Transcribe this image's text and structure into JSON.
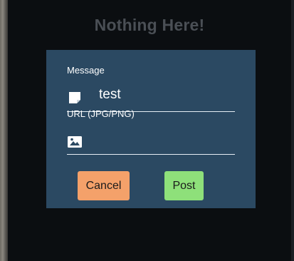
{
  "page": {
    "title": "Nothing Here!"
  },
  "form": {
    "message_label": "Message",
    "message_value": "test",
    "url_label": "URL (JPG/PNG)",
    "url_value": ""
  },
  "buttons": {
    "cancel_label": "Cancel",
    "post_label": "Post"
  },
  "colors": {
    "panel": "#2b4962",
    "cancel": "#f4a16a",
    "post": "#8ee07a",
    "title": "#4a4f55"
  },
  "icons": {
    "message": "note-icon",
    "url": "image-icon"
  }
}
